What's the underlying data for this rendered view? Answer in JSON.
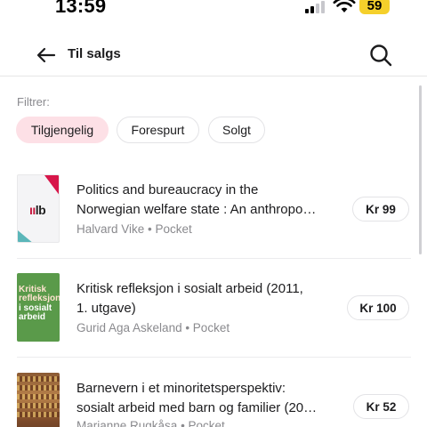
{
  "status_bar": {
    "time": "13:59",
    "battery": "59"
  },
  "header": {
    "title": "Til salgs"
  },
  "filters": {
    "label": "Filtrer:",
    "chips": [
      {
        "label": "Tilgjengelig",
        "active": true
      },
      {
        "label": "Forespurt",
        "active": false
      },
      {
        "label": "Solgt",
        "active": false
      }
    ]
  },
  "items": [
    {
      "title_line1": "Politics and bureaucracy in the",
      "title_line2": "Norwegian welfare state : An anthropo…",
      "meta": "Halvard Vike • Pocket",
      "price": "Kr 99",
      "cover_text": "lb"
    },
    {
      "title_line1": "Kritisk refleksjon i sosialt arbeid (2011,",
      "title_line2": "1. utgave)",
      "meta": "Gurid Aga Askeland • Pocket",
      "price": "Kr 100",
      "cover_lines": [
        "Kritisk",
        "refleksjon",
        "i sosialt",
        "arbeid"
      ]
    },
    {
      "title_line1": "Barnevern i et minoritetsperspektiv:",
      "title_line2": "sosialt arbeid med barn og familier (20…",
      "meta": "Marianne Rugkåsa • Pocket",
      "price": "Kr 52"
    }
  ],
  "colors": {
    "accent_chip": "#fde0e6",
    "status_battery": "#f5d02b"
  },
  "icons": {
    "back": "arrow-left-icon",
    "search": "search-icon"
  }
}
